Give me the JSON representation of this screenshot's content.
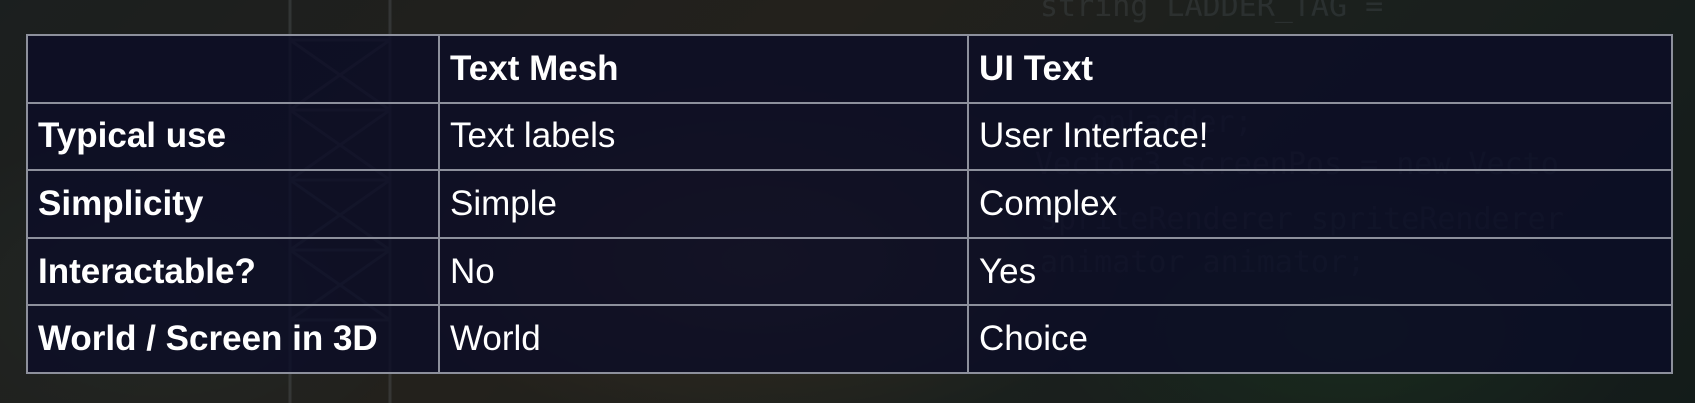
{
  "table": {
    "headers": [
      "",
      "Text Mesh",
      "UI Text"
    ],
    "rows": [
      {
        "label": "Typical use",
        "text_mesh": "Text labels",
        "ui_text": "User Interface!"
      },
      {
        "label": "Simplicity",
        "text_mesh": "Simple",
        "ui_text": "Complex"
      },
      {
        "label": "Interactable?",
        "text_mesh": "No",
        "ui_text": "Yes"
      },
      {
        "label": "World / Screen in 3D",
        "text_mesh": "World",
        "ui_text": "Choice"
      }
    ]
  },
  "colors": {
    "table_background": "#0a0c26",
    "grid_line": "#8d909c",
    "text": "#ffffff"
  }
}
